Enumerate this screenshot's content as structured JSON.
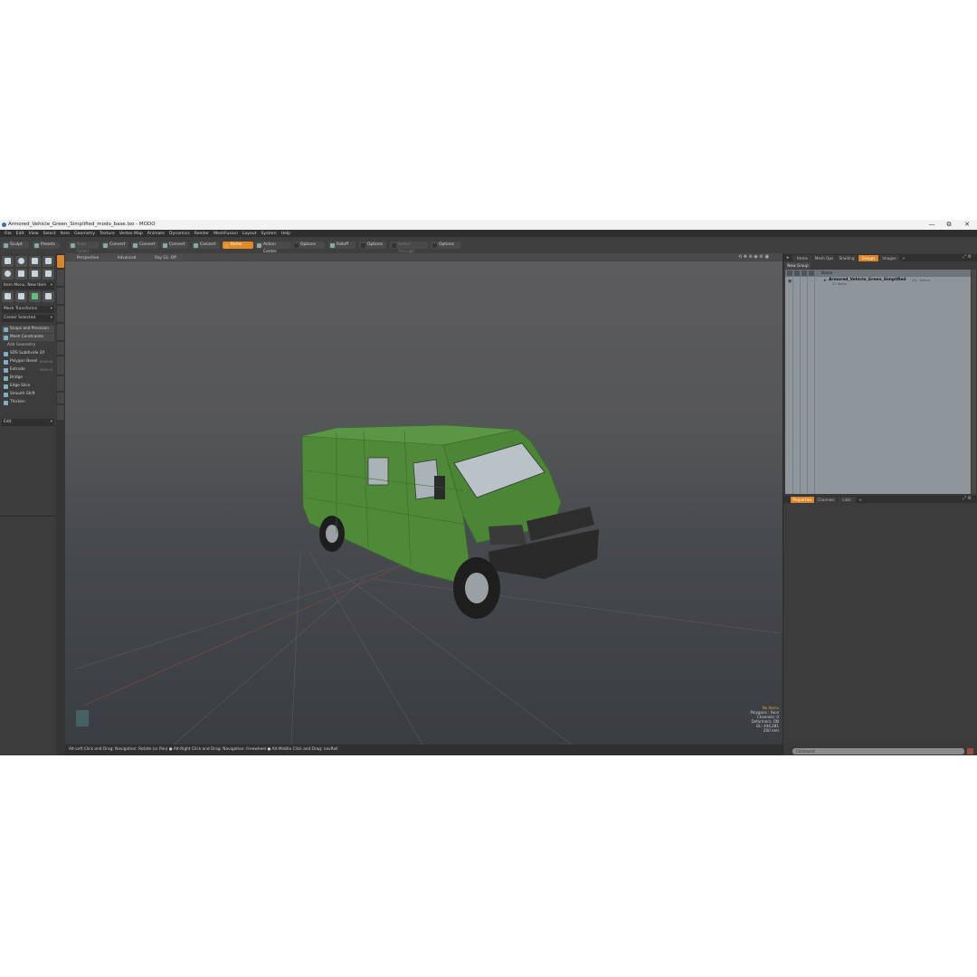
{
  "window": {
    "title": "Armored_Vehicle_Green_Simplified_modo_base.lxo - MODO",
    "controls": [
      "—",
      "⧉",
      "✕"
    ]
  },
  "menu": [
    "File",
    "Edit",
    "View",
    "Select",
    "Item",
    "Geometry",
    "Texture",
    "Vertex Map",
    "Animate",
    "Dynamics",
    "Render",
    "MeshFusion",
    "Layout",
    "System",
    "Help"
  ],
  "toolbar": {
    "sculpt": "Sculpt",
    "presets": "Presets",
    "auto_select": "Auto Select",
    "convert": "Convert",
    "items": "Items",
    "action_center": "Action Center",
    "options": "Options",
    "falloff": "Falloff",
    "select_through": "Select Through"
  },
  "left_panel": {
    "item_menu": "Item Menu: New Item",
    "mesh_transforms": "Mesh Transforms",
    "center_selected": "Center Selected",
    "snaps": "Snaps and Precision",
    "mesh_constraints": "Mesh Constraints",
    "add_geometry": "Add Geometry",
    "tools": [
      {
        "label": "SDS Subdivide 2X",
        "shortcut": ""
      },
      {
        "label": "Polygon Bevel",
        "shortcut": "Shift+B"
      },
      {
        "label": "Extrude",
        "shortcut": "Shift+X"
      },
      {
        "label": "Bridge",
        "shortcut": ""
      },
      {
        "label": "Edge Slice",
        "shortcut": ""
      },
      {
        "label": "Smooth Shift",
        "shortcut": ""
      },
      {
        "label": "Thicken",
        "shortcut": ""
      }
    ],
    "edit_dropdown": "Edit"
  },
  "viewport": {
    "tabs": [
      "Perspective",
      "Advanced",
      "Ray GL: Off"
    ],
    "hud": {
      "no_items": "No Items",
      "polygons": "Polygons : Face",
      "channels": "Channels: 0",
      "deformers": "Deformers: ON",
      "gl": "GL: 444,281",
      "distance": "200 mm"
    }
  },
  "status_bar": "Alt-Left Click and Drag: Navigation: Rotate (or Pan) ● Alt-Right Click and Drag: Navigation: Freewheel ● Alt-Middle Click and Drag: navRoll",
  "right_panel": {
    "top_tabs": [
      "Items",
      "Mesh Ops",
      "Shading",
      "Groups",
      "Images",
      "+"
    ],
    "active_top_tab": "Groups",
    "new_group": "New Group",
    "name_header": "Name",
    "group": {
      "name": "Armored_Vehicle_Green_Simplified",
      "count": "(3) : Items",
      "sub": "22 items"
    },
    "bottom_tabs": [
      "Properties",
      "Channels",
      "Lists",
      "+"
    ],
    "active_bottom_tab": "Properties",
    "command_placeholder": "Command"
  },
  "colors": {
    "accent": "#e08a2a",
    "vehicle_green": "#4e8a38",
    "ui_dark": "#3a3a3a"
  }
}
